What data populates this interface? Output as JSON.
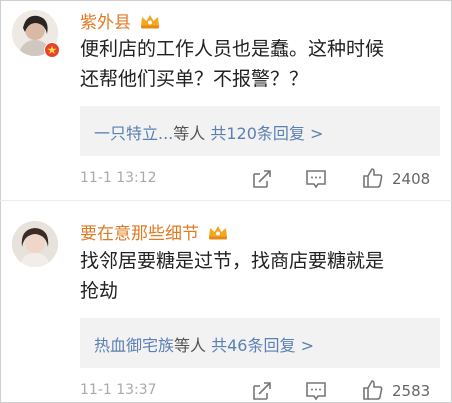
{
  "comments": [
    {
      "username": "紫外县",
      "text_line1": "便利店的工作人员也是蠢。这种时候",
      "text_line2": "还帮他们买单？不报警？？",
      "reply_names": "一只特立...",
      "reply_etc": "等人",
      "reply_count": "共120条回复 >",
      "time": "11-1 13:12",
      "likes": "2408"
    },
    {
      "username": "要在意那些细节",
      "text_line1": "找邻居要糖是过节，找商店要糖就是",
      "text_line2": "抢劫",
      "reply_names": "热血御宅族",
      "reply_etc": "等人",
      "reply_count": "共46条回复 >",
      "time": "11-1 13:37",
      "likes": "2583"
    }
  ],
  "colors": {
    "username": "#e07b25",
    "link": "#5b80b2",
    "meta": "#aaaaaa",
    "reply_bg": "#f2f2f2"
  },
  "icons": [
    "vip-crown-icon",
    "verified-badge-icon",
    "share-icon",
    "comment-icon",
    "like-icon"
  ]
}
